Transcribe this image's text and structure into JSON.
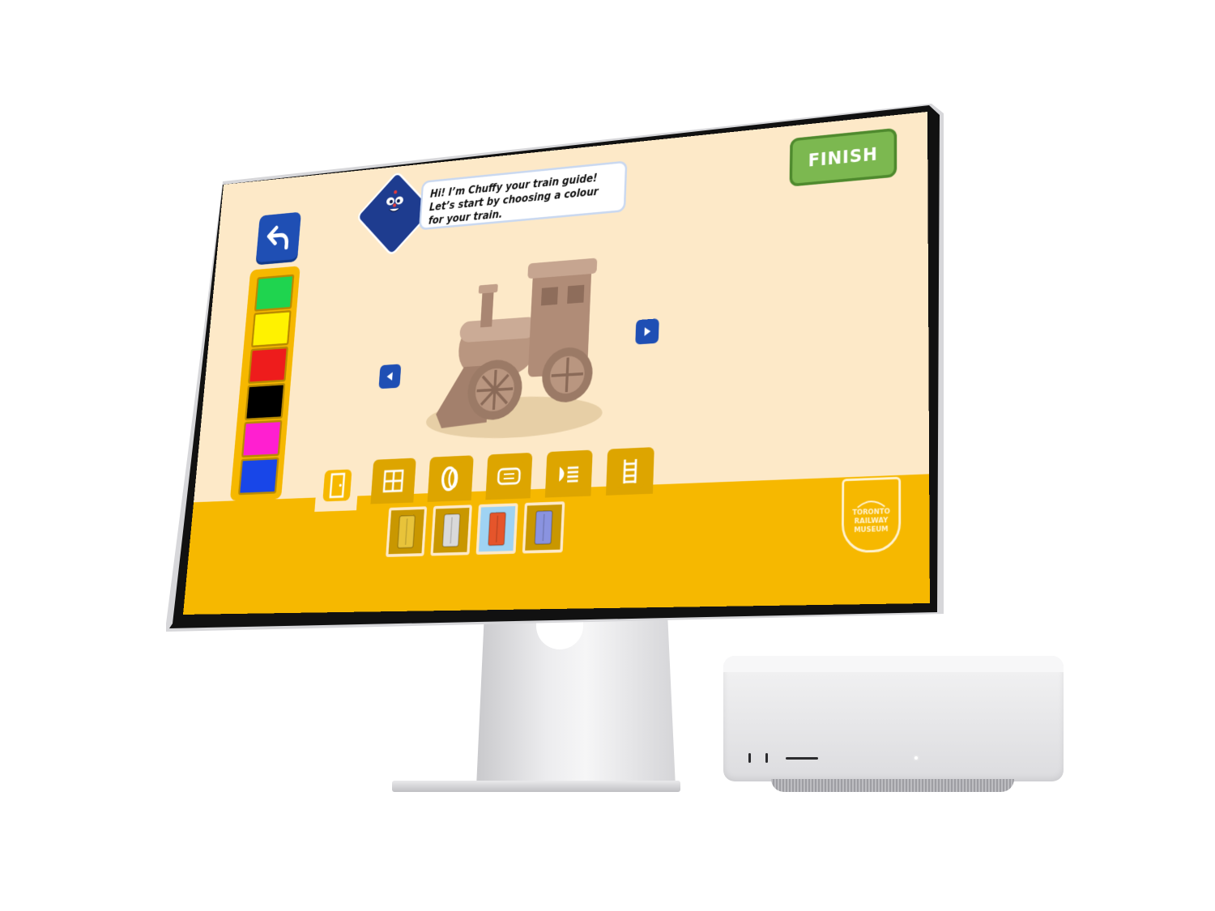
{
  "app": {
    "guide_message": "Hi! I’m Chuffy your train guide! Let’s start by choosing a colour for your train.",
    "finish_label": "FINISH",
    "museum_logo": [
      "TORONTO",
      "RAILWAY",
      "MUSEUM"
    ]
  },
  "palette": {
    "colors": [
      "#1fd44f",
      "#fff200",
      "#ee1c1c",
      "#000000",
      "#ff1fd0",
      "#1846e8"
    ]
  },
  "category_tabs": [
    {
      "icon": "door-icon",
      "active": true
    },
    {
      "icon": "window-icon",
      "active": false
    },
    {
      "icon": "wheel-icon",
      "active": false
    },
    {
      "icon": "panel-icon",
      "active": false
    },
    {
      "icon": "headlight-icon",
      "active": false
    },
    {
      "icon": "ladder-icon",
      "active": false
    }
  ],
  "door_options": [
    {
      "icon": "yellow-door-icon",
      "color": "#e8c33a",
      "selected": false
    },
    {
      "icon": "glass-door-icon",
      "color": "#d9d9d9",
      "selected": false
    },
    {
      "icon": "red-door-icon",
      "color": "#e5552b",
      "selected": true
    },
    {
      "icon": "blue-door-icon",
      "color": "#8a93e0",
      "selected": false
    }
  ],
  "colors": {
    "background": "#fde9c8",
    "accent_blue": "#1f4fb4",
    "bar_yellow": "#f6b800",
    "finish_green": "#7cb850"
  }
}
